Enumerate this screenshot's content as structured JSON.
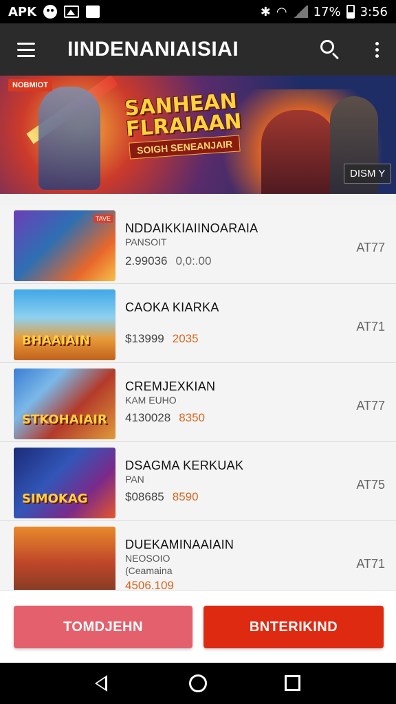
{
  "status_bar": {
    "left_label": "APK",
    "battery": "17%",
    "time": "3:56"
  },
  "app_bar": {
    "title": "IINDENANIAISIAI"
  },
  "banner": {
    "badge": "NOBMIOT",
    "title_line1": "SANHEAN",
    "title_line2": "FLRAIAAN",
    "subtitle": "SOIGH SENEANJAIR",
    "dismiss_label": "DISM Y"
  },
  "list": {
    "items": [
      {
        "title": "NDDAIKKIAIINOARAIA",
        "subtitle": "PANSOIT",
        "subtitle2": "",
        "price": "2.99036",
        "price_alt": "0,0:.00",
        "right_label": "AT77",
        "thumb_tag": "TAVE",
        "thumb_logo": ""
      },
      {
        "title": "CAOKA KIARKA",
        "subtitle": "",
        "subtitle2": "",
        "price": "$13999",
        "price_alt": "2035",
        "right_label": "AT71",
        "thumb_tag": "",
        "thumb_logo": "BHAAIAIN"
      },
      {
        "title": "CREMJEXKIAN",
        "subtitle": "KAM EUHO",
        "subtitle2": "",
        "price": "4130028",
        "price_alt": "8350",
        "right_label": "AT77",
        "thumb_tag": "",
        "thumb_logo": "STKOHAIAIR"
      },
      {
        "title": "DSAGMA KERKUAK",
        "subtitle": "PAN",
        "subtitle2": "",
        "price": "$08685",
        "price_alt": "8590",
        "right_label": "AT75",
        "thumb_tag": "",
        "thumb_logo": "SIMOKAG"
      },
      {
        "title": "DUEKAMINAAIAIN",
        "subtitle": "NEOSOIO",
        "subtitle2": "(Ceamaina",
        "price": "4506.109",
        "price_alt": "",
        "right_label": "AT71",
        "thumb_tag": "",
        "thumb_logo": ""
      }
    ]
  },
  "bottom_bar": {
    "left_button": "TOMDJEHN",
    "right_button": "BNTERIKIND"
  },
  "colors": {
    "app_bar": "#2b2b2b",
    "left_button": "#e4606c",
    "right_button": "#df2a12",
    "price_accent": "#d8661e"
  },
  "icons": [
    "menu-icon",
    "search-icon",
    "more-vert-icon",
    "back-icon",
    "home-icon",
    "recents-icon"
  ]
}
